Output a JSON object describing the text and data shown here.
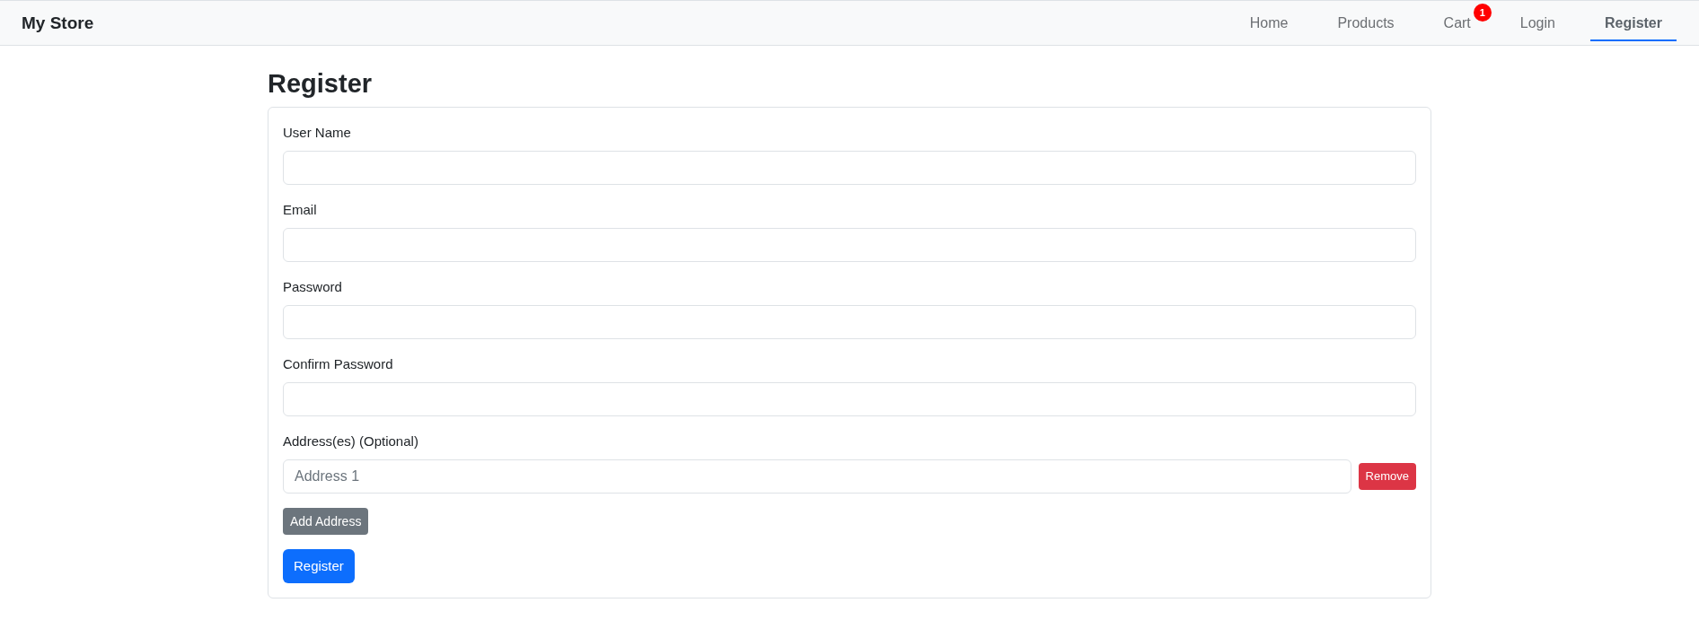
{
  "navbar": {
    "brand": "My Store",
    "links": [
      {
        "label": "Home",
        "selected": false
      },
      {
        "label": "Products",
        "selected": false
      },
      {
        "label": "Cart",
        "selected": false,
        "badge": "1"
      },
      {
        "label": "Login",
        "selected": false
      },
      {
        "label": "Register",
        "selected": true
      }
    ]
  },
  "page": {
    "title": "Register"
  },
  "form": {
    "fields": [
      {
        "label": "User Name"
      },
      {
        "label": "Email"
      },
      {
        "label": "Password"
      },
      {
        "label": "Confirm Password"
      }
    ],
    "addresses": {
      "label": "Address(es) (Optional)",
      "items": [
        {
          "placeholder": "Address 1",
          "remove_button": "Remove"
        }
      ],
      "add_button": "Add Address"
    },
    "submit_button": "Register"
  }
}
